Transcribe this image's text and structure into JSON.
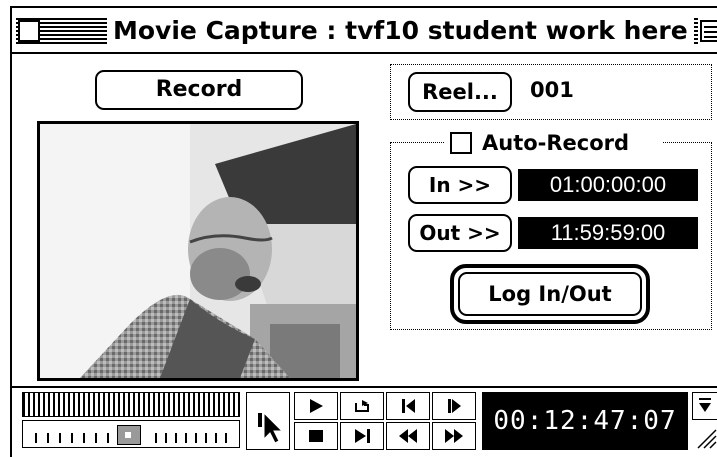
{
  "window": {
    "title": "Movie Capture : tvf10 student work here"
  },
  "record_button": {
    "label": "Record"
  },
  "reel": {
    "button_label": "Reel...",
    "value": "001"
  },
  "auto_record": {
    "label": "Auto-Record",
    "checked": false
  },
  "in_point": {
    "button_label": "In >>",
    "timecode": "01:00:00:00"
  },
  "out_point": {
    "button_label": "Out >>",
    "timecode": "11:59:59:00"
  },
  "log_button": {
    "label": "Log In/Out"
  },
  "transport": {
    "timecode": "00:12:47:07"
  },
  "icons": [
    "close-box-icon",
    "zoom-box-icon",
    "pointer-arrow-icon",
    "pause-icon",
    "play-icon",
    "stop-icon",
    "loop-icon",
    "step-forward-icon",
    "frame-back-icon",
    "frame-forward-icon",
    "rewind-icon",
    "fast-forward-icon",
    "size-box-icon"
  ],
  "colors": {
    "background": "#ffffff",
    "foreground": "#000000",
    "timecode_bg": "#000000",
    "timecode_text": "#ffffff"
  }
}
